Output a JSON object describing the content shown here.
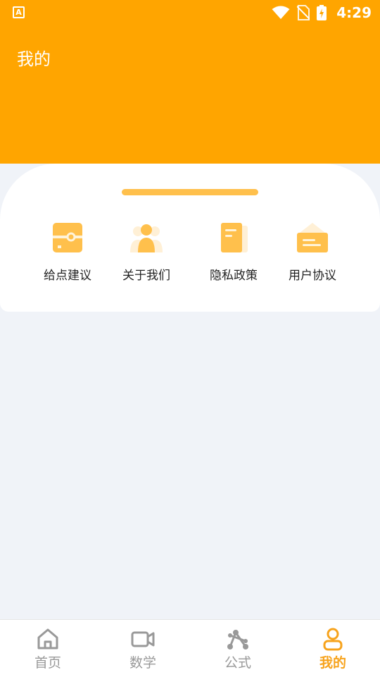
{
  "status_bar": {
    "app_badge": "A",
    "time": "4:29",
    "icons": [
      "wifi-icon",
      "no-sim-icon",
      "battery-charging-icon"
    ]
  },
  "header": {
    "title": "我的",
    "background": "#ffa500"
  },
  "menu": {
    "items": [
      {
        "label": "给点建议",
        "icon": "feedback-icon"
      },
      {
        "label": "关于我们",
        "icon": "people-icon"
      },
      {
        "label": "隐私政策",
        "icon": "document-icon"
      },
      {
        "label": "用户协议",
        "icon": "agreement-icon"
      }
    ],
    "accent": "#ffc04c"
  },
  "tabbar": {
    "items": [
      {
        "label": "首页",
        "icon": "home-icon",
        "active": false
      },
      {
        "label": "数学",
        "icon": "video-icon",
        "active": false
      },
      {
        "label": "公式",
        "icon": "formula-icon",
        "active": false
      },
      {
        "label": "我的",
        "icon": "user-icon",
        "active": true
      }
    ],
    "active_color": "#f7a31c",
    "inactive_color": "#999999"
  }
}
